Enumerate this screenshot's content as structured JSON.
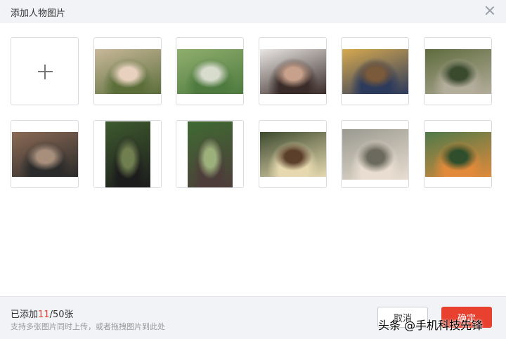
{
  "dialog": {
    "title": "添加人物图片",
    "close_icon": "close-icon"
  },
  "grid": {
    "add_icon": "plus-icon",
    "photos": [
      {
        "name": "photo-1",
        "colors": [
          "#c9b89a",
          "#5b6e3a",
          "#e8d2bf"
        ]
      },
      {
        "name": "photo-2",
        "colors": [
          "#8fae6d",
          "#4e7a3f",
          "#d8dccd"
        ]
      },
      {
        "name": "photo-3",
        "colors": [
          "#e9e6e4",
          "#3a2c28",
          "#c7a18c"
        ]
      },
      {
        "name": "photo-4",
        "colors": [
          "#d6a94f",
          "#2c3a5c",
          "#7a5a3a"
        ]
      },
      {
        "name": "photo-5",
        "colors": [
          "#5e6b3c",
          "#b3ad9b",
          "#3a4a2c"
        ]
      },
      {
        "name": "photo-6",
        "colors": [
          "#8b6a55",
          "#2b2b2b",
          "#a88f7b"
        ]
      },
      {
        "name": "photo-7",
        "colors": [
          "#3e5a2e",
          "#1c1c1c",
          "#6f7f4f"
        ]
      },
      {
        "name": "photo-8",
        "colors": [
          "#3f6a32",
          "#4d3d3a",
          "#9bb07a"
        ]
      },
      {
        "name": "photo-9",
        "colors": [
          "#3d4a2e",
          "#e6d9b0",
          "#5b3f2a"
        ]
      },
      {
        "name": "photo-10",
        "colors": [
          "#9a9a90",
          "#e8ddd0",
          "#6c6a5e"
        ]
      },
      {
        "name": "photo-11",
        "colors": [
          "#4f7a4a",
          "#e08a3a",
          "#2f4f2c"
        ]
      }
    ]
  },
  "footer": {
    "count_prefix": "已添加",
    "count_value": "11",
    "count_suffix": "/50张",
    "hint": "支持多张图片同时上传，或者拖拽图片到此处",
    "cancel_label": "取消",
    "ok_label": "确定"
  },
  "watermark": "头条 @手机科技先锋",
  "colors": {
    "accent": "#e8412f",
    "header_bg": "#f2f3f7"
  }
}
